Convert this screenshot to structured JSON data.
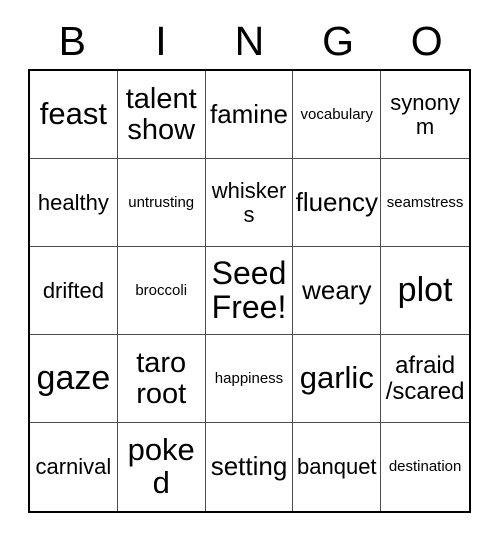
{
  "card": {
    "header": {
      "letters": [
        "B",
        "I",
        "N",
        "G",
        "O"
      ]
    },
    "free_space": {
      "text": "Seed\nFree!",
      "row": 3,
      "column": 3
    },
    "rows": [
      [
        {
          "text": "feast",
          "size": "lg"
        },
        {
          "text": "talent\nshow",
          "size": "two"
        },
        {
          "text": "famine",
          "size": "md"
        },
        {
          "text": "vocabulary",
          "size": "xs"
        },
        {
          "text": "synonym",
          "size": "sm"
        }
      ],
      [
        {
          "text": "healthy",
          "size": "sm"
        },
        {
          "text": "untrusting",
          "size": "xs"
        },
        {
          "text": "whiskers",
          "size": "sm"
        },
        {
          "text": "fluency",
          "size": "md"
        },
        {
          "text": "seamstress",
          "size": "xs"
        }
      ],
      [
        {
          "text": "drifted",
          "size": "sm"
        },
        {
          "text": "broccoli",
          "size": "xs"
        },
        {
          "text": "Seed\nFree!",
          "size": "free"
        },
        {
          "text": "weary",
          "size": "md"
        },
        {
          "text": "plot",
          "size": "xl"
        }
      ],
      [
        {
          "text": "gaze",
          "size": "xl"
        },
        {
          "text": "taro\nroot",
          "size": "two"
        },
        {
          "text": "happiness",
          "size": "xs"
        },
        {
          "text": "garlic",
          "size": "lg"
        },
        {
          "text": "afraid\n/scared",
          "size": "two-sm"
        }
      ],
      [
        {
          "text": "carnival",
          "size": "sm"
        },
        {
          "text": "poked",
          "size": "lg"
        },
        {
          "text": "setting",
          "size": "md"
        },
        {
          "text": "banquet",
          "size": "sm"
        },
        {
          "text": "destination",
          "size": "xs"
        }
      ]
    ],
    "colors": {
      "background": "#ffffff",
      "text": "#000000",
      "outer_border": "#000000",
      "grid_line": "#4d4d4d"
    }
  }
}
